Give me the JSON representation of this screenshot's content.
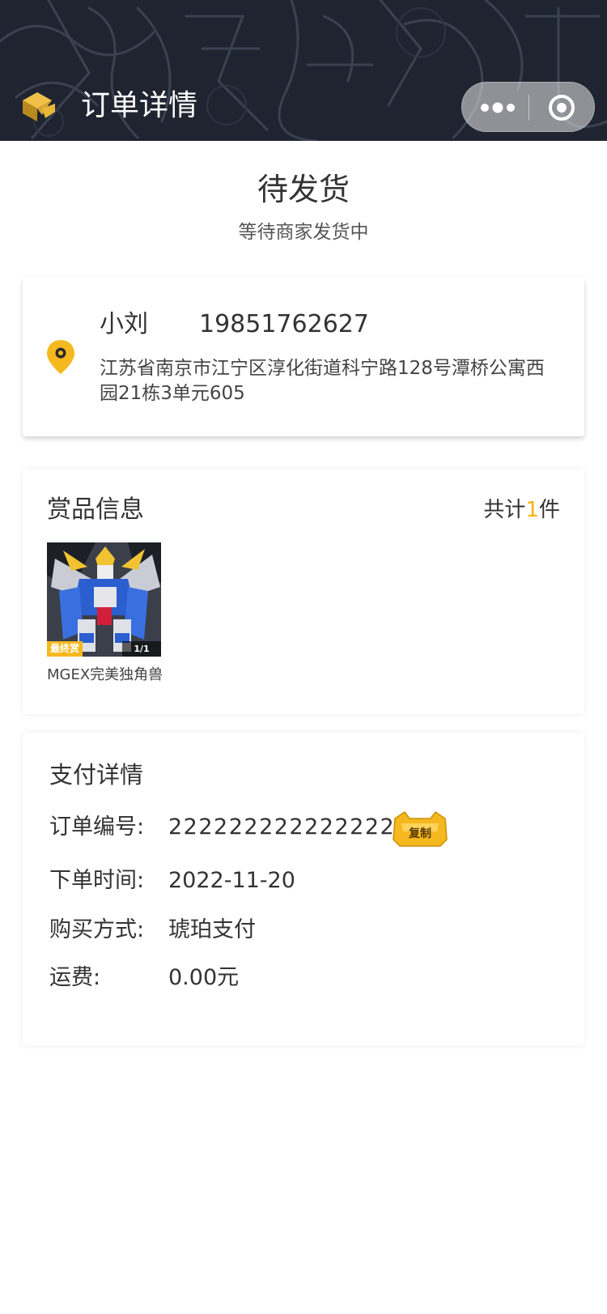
{
  "header": {
    "title": "订单详情",
    "accent": "#f5b400",
    "bg_color": "#1f2430"
  },
  "status": {
    "title": "待发货",
    "subtitle": "等待商家发货中"
  },
  "address": {
    "name": "小刘",
    "phone": "19851762627",
    "detail": "江苏省南京市江宁区淳化街道科宁路128号潭桥公寓西园21栋3单元605",
    "icon": "location-pin-icon"
  },
  "prize": {
    "heading": "赏品信息",
    "total_prefix": "共计",
    "total_count": "1",
    "total_suffix": "件",
    "items": [
      {
        "name": "MGEX完美独角兽",
        "badge": "最终赏",
        "fraction": "1/1"
      }
    ]
  },
  "payment": {
    "heading": "支付详情",
    "rows": [
      {
        "label": "订单编号:",
        "value": "2222222222222222"
      },
      {
        "label": "下单时间:",
        "value": "2022-11-20"
      },
      {
        "label": "购买方式:",
        "value": "琥珀支付"
      },
      {
        "label": "运费:",
        "value": "0.00元"
      }
    ],
    "copy_label": "复制"
  }
}
